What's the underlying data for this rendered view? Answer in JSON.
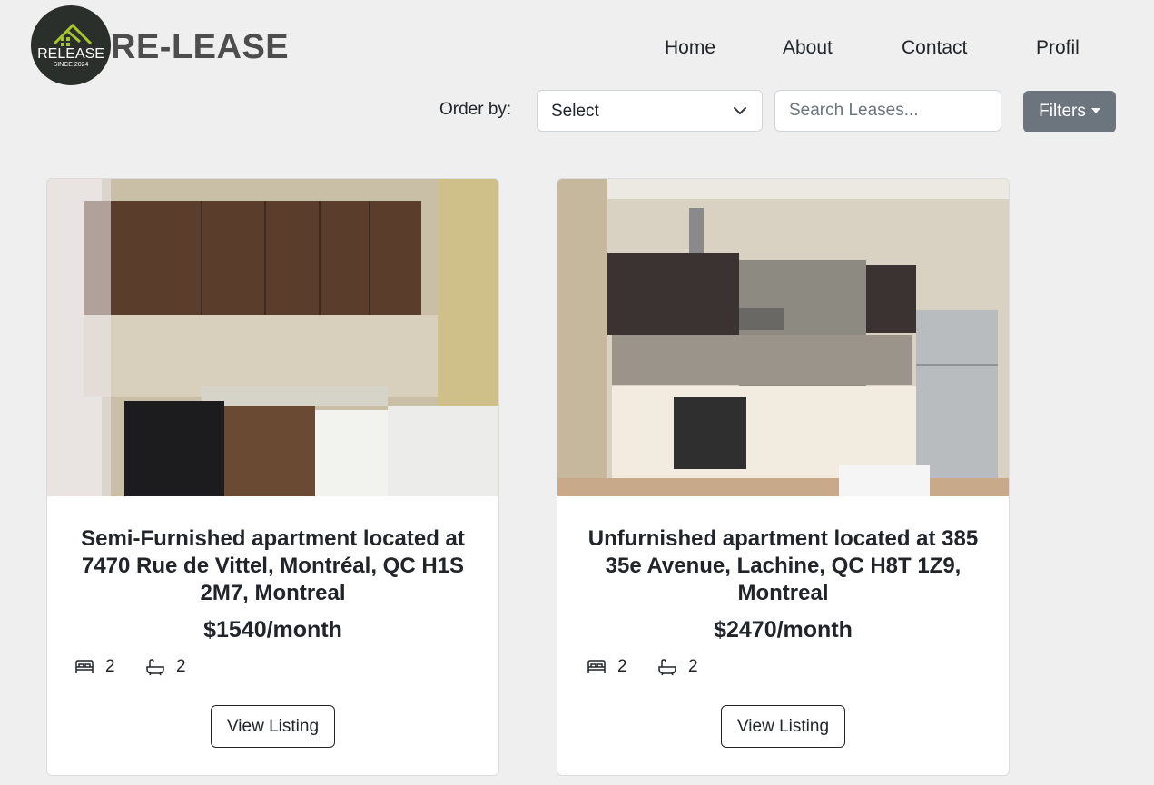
{
  "header": {
    "logo_text": "RELEASE",
    "logo_subtext": "SINCE 2024",
    "brand": "RE-LEASE",
    "nav": [
      "Home",
      "About",
      "Contact",
      "Profil"
    ]
  },
  "toolbar": {
    "order_label": "Order by:",
    "order_select": "Select",
    "search_placeholder": "Search Leases...",
    "filters_label": "Filters"
  },
  "listings": [
    {
      "title": "Semi-Furnished apartment located at 7470 Rue de Vittel, Montréal, QC H1S 2M7, Montreal",
      "price": "$1540/month",
      "bedrooms": "2",
      "bathrooms": "2",
      "button": "View Listing"
    },
    {
      "title": "Unfurnished apartment located at 385 35e Avenue, Lachine, QC H8T 1Z9, Montreal",
      "price": "$2470/month",
      "bedrooms": "2",
      "bathrooms": "2",
      "button": "View Listing"
    }
  ],
  "icons": {
    "bed": "bed-icon",
    "bath": "bath-icon",
    "chevron": "chevron-down-icon"
  },
  "colors": {
    "background": "#efefef",
    "filters_button": "#6c757d",
    "brand_text": "#4d4d4d",
    "logo_bg": "#2b2f2b",
    "logo_accent": "#a6c630"
  }
}
